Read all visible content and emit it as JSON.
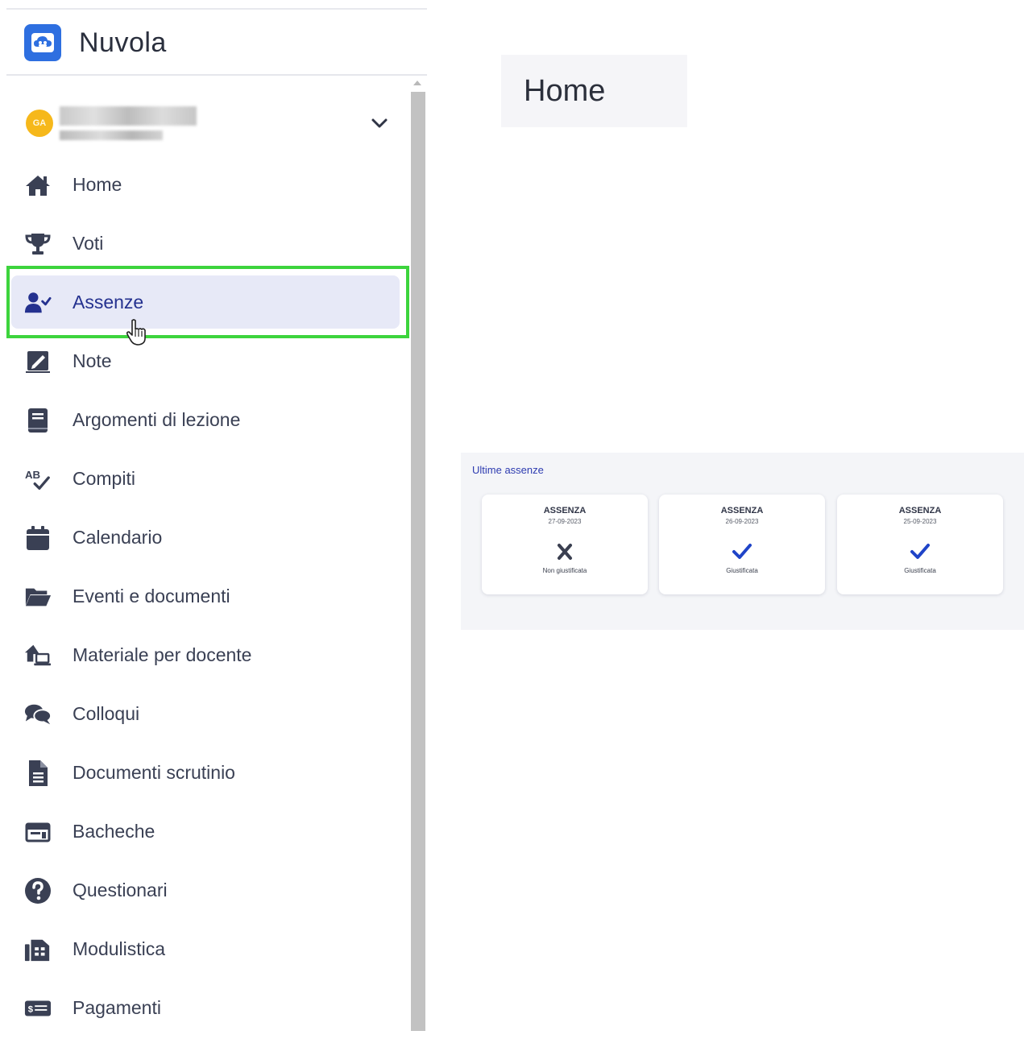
{
  "app": {
    "name": "Nuvola"
  },
  "user": {
    "initials": "GA"
  },
  "sidebar": {
    "items": [
      {
        "label": "Home",
        "icon": "home-icon",
        "active": false
      },
      {
        "label": "Voti",
        "icon": "trophy-icon",
        "active": false
      },
      {
        "label": "Assenze",
        "icon": "user-check-icon",
        "active": true
      },
      {
        "label": "Note",
        "icon": "note-icon",
        "active": false
      },
      {
        "label": "Argomenti di lezione",
        "icon": "book-icon",
        "active": false
      },
      {
        "label": "Compiti",
        "icon": "spellcheck-icon",
        "active": false
      },
      {
        "label": "Calendario",
        "icon": "calendar-icon",
        "active": false
      },
      {
        "label": "Eventi e documenti",
        "icon": "folder-open-icon",
        "active": false
      },
      {
        "label": "Materiale per docente",
        "icon": "house-laptop-icon",
        "active": false
      },
      {
        "label": "Colloqui",
        "icon": "comments-icon",
        "active": false
      },
      {
        "label": "Documenti scrutinio",
        "icon": "file-icon",
        "active": false
      },
      {
        "label": "Bacheche",
        "icon": "board-icon",
        "active": false
      },
      {
        "label": "Questionari",
        "icon": "question-icon",
        "active": false
      },
      {
        "label": "Modulistica",
        "icon": "forms-icon",
        "active": false
      },
      {
        "label": "Pagamenti",
        "icon": "payment-icon",
        "active": false
      }
    ]
  },
  "main": {
    "page_title": "Home",
    "absences": {
      "title": "Ultime assenze",
      "cards": [
        {
          "type": "ASSENZA",
          "date": "27-09-2023",
          "status": "Non giustificata",
          "icon": "x-icon"
        },
        {
          "type": "ASSENZA",
          "date": "26-09-2023",
          "status": "Giustificata",
          "icon": "check-icon"
        },
        {
          "type": "ASSENZA",
          "date": "25-09-2023",
          "status": "Giustificata",
          "icon": "check-icon"
        }
      ]
    }
  },
  "colors": {
    "brand_blue": "#2e6fe0",
    "active_bg": "#e7e9f7",
    "active_text": "#24318f",
    "highlight_green": "#3dd43d",
    "check_blue": "#1f44c8",
    "avatar_yellow": "#f6b81b"
  }
}
